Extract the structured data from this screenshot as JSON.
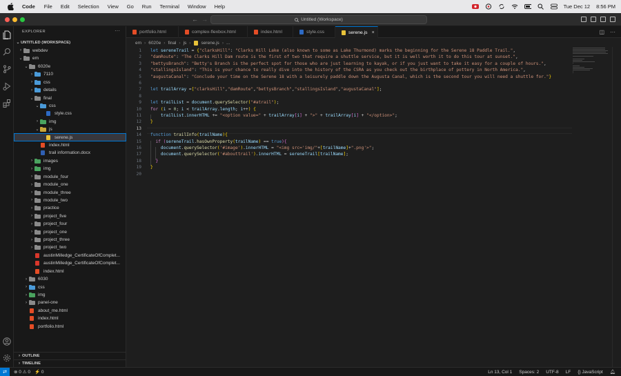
{
  "menubar": {
    "app": "Code",
    "items": [
      "File",
      "Edit",
      "Selection",
      "View",
      "Go",
      "Run",
      "Terminal",
      "Window",
      "Help"
    ],
    "clock_date": "Tue Dec 12",
    "clock_time": "8:56 PM"
  },
  "titlebar": {
    "command_center": "Untitled (Workspace)"
  },
  "sidebar": {
    "title": "EXPLORER",
    "workspace": "UNTITLED (WORKSPACE)",
    "tree": [
      {
        "label": "webdev",
        "icon": "folder",
        "indent": 1,
        "chevron": "›"
      },
      {
        "label": "em",
        "icon": "folder",
        "indent": 1,
        "chevron": "⌄"
      },
      {
        "label": "6020e",
        "icon": "folder",
        "indent": 2,
        "chevron": "⌄"
      },
      {
        "label": "7110",
        "icon": "folder blue",
        "indent": 3,
        "chevron": "›"
      },
      {
        "label": "css",
        "icon": "folder blue",
        "indent": 3,
        "chevron": "›"
      },
      {
        "label": "details",
        "icon": "folder blue",
        "indent": 3,
        "chevron": "›"
      },
      {
        "label": "final",
        "icon": "folder",
        "indent": 3,
        "chevron": "⌄"
      },
      {
        "label": "css",
        "icon": "folder blue",
        "indent": 4,
        "chevron": "⌄"
      },
      {
        "label": "style.css",
        "icon": "file-css",
        "indent": 5,
        "chevron": ""
      },
      {
        "label": "img",
        "icon": "folder green",
        "indent": 4,
        "chevron": "›"
      },
      {
        "label": "js",
        "icon": "folder yellow",
        "indent": 4,
        "chevron": "⌄"
      },
      {
        "label": "serene.js",
        "icon": "file-js",
        "indent": 5,
        "chevron": "",
        "selected": true
      },
      {
        "label": "index.html",
        "icon": "file-html",
        "indent": 4,
        "chevron": ""
      },
      {
        "label": "trail information.docx",
        "icon": "file-doc",
        "indent": 4,
        "chevron": ""
      },
      {
        "label": "images",
        "icon": "folder green",
        "indent": 3,
        "chevron": "›"
      },
      {
        "label": "img",
        "icon": "folder green",
        "indent": 3,
        "chevron": "›"
      },
      {
        "label": "module_four",
        "icon": "folder",
        "indent": 3,
        "chevron": "›"
      },
      {
        "label": "module_one",
        "icon": "folder",
        "indent": 3,
        "chevron": "›"
      },
      {
        "label": "module_three",
        "icon": "folder",
        "indent": 3,
        "chevron": "›"
      },
      {
        "label": "module_two",
        "icon": "folder",
        "indent": 3,
        "chevron": "›"
      },
      {
        "label": "practice",
        "icon": "folder",
        "indent": 3,
        "chevron": "›"
      },
      {
        "label": "project_five",
        "icon": "folder",
        "indent": 3,
        "chevron": "›"
      },
      {
        "label": "project_four",
        "icon": "folder",
        "indent": 3,
        "chevron": "›"
      },
      {
        "label": "project_one",
        "icon": "folder",
        "indent": 3,
        "chevron": "›"
      },
      {
        "label": "project_three",
        "icon": "folder",
        "indent": 3,
        "chevron": "›"
      },
      {
        "label": "project_two",
        "icon": "folder",
        "indent": 3,
        "chevron": "›"
      },
      {
        "label": "austinMilledge_CertificateOfComplet...",
        "icon": "file-pdf",
        "indent": 3,
        "chevron": ""
      },
      {
        "label": "austinMilledge_CertificateOfComplet...",
        "icon": "file-pdf",
        "indent": 3,
        "chevron": ""
      },
      {
        "label": "index.html",
        "icon": "file-html",
        "indent": 3,
        "chevron": ""
      },
      {
        "label": "6030",
        "icon": "folder",
        "indent": 2,
        "chevron": "›"
      },
      {
        "label": "css",
        "icon": "folder blue",
        "indent": 2,
        "chevron": "›"
      },
      {
        "label": "img",
        "icon": "folder green",
        "indent": 2,
        "chevron": "›"
      },
      {
        "label": "panel-one",
        "icon": "folder",
        "indent": 2,
        "chevron": "›"
      },
      {
        "label": "about_me.html",
        "icon": "file-html",
        "indent": 2,
        "chevron": ""
      },
      {
        "label": "index.html",
        "icon": "file-html",
        "indent": 2,
        "chevron": ""
      },
      {
        "label": "portfolio.html",
        "icon": "file-html",
        "indent": 2,
        "chevron": ""
      }
    ],
    "outline": "OUTLINE",
    "timeline": "TIMELINE"
  },
  "tabs": [
    {
      "label": "portfolio.html",
      "icon": "file-html"
    },
    {
      "label": "complex-flexbox.html",
      "icon": "file-html"
    },
    {
      "label": "index.html",
      "icon": "file-html"
    },
    {
      "label": "style.css",
      "icon": "file-css"
    },
    {
      "label": "serene.js",
      "icon": "file-js",
      "active": true
    }
  ],
  "breadcrumb": [
    "em",
    "6020e",
    "final",
    "js",
    "serene.js",
    "..."
  ],
  "code": {
    "current_line": 13,
    "lines": [
      "<span class=\"k\">let</span> <span class=\"v\">sereneTrail</span> <span class=\"p\">=</span> <span class=\"br\">{</span><span class=\"s\">\"clarksHill\"</span><span class=\"p\">: </span><span class=\"s\">\"Clarks Hill Lake (also known to some as Lake Thurmond) marks the beginning for the Serene 18 Paddle Trail.\"</span><span class=\"p\">,</span>",
      "<span class=\"s\">\"damRoute\"</span><span class=\"p\">: </span><span class=\"s\">\"The Clarks Hill Dam route is the first of two that require a shuttle service, but it is well worth it to do this tour at sunset.\"</span><span class=\"p\">,</span>",
      "<span class=\"s\">\"bettysBranch\"</span><span class=\"p\">: </span><span class=\"s\">\"Betty's Branch is the perfect spot for those who are just learning to kayak, or if you just want to take it easy for a couple of hours.\"</span><span class=\"p\">,</span>",
      "<span class=\"s\">\"stallingsIsland\"</span><span class=\"p\">: </span><span class=\"s\">\"This is your chance to really dive into the history of the CSRA as you check out the birthplace of pottery in North America.\"</span><span class=\"p\">,</span>",
      "<span class=\"s\">\"augustaCanal\"</span><span class=\"p\">: </span><span class=\"s\">\"Conclude your time on the Serene 18 with a leisurely paddle down the Augusta Canal, which is the second tour you will need a shuttle for.\"</span><span class=\"br\">}</span>",
      "",
      "<span class=\"k\">let</span> <span class=\"v\">trailArray</span> <span class=\"p\">=</span><span class=\"br\">[</span><span class=\"s\">\"clarksHill\"</span><span class=\"p\">,</span><span class=\"s\">\"damRoute\"</span><span class=\"p\">,</span><span class=\"s\">\"bettysBranch\"</span><span class=\"p\">,</span><span class=\"s\">\"stallingsIsland\"</span><span class=\"p\">,</span><span class=\"s\">\"augustaCanal\"</span><span class=\"br\">]</span><span class=\"p\">;</span>",
      "",
      "<span class=\"k\">let</span> <span class=\"v\">trailList</span> <span class=\"p\">= </span><span class=\"v\">document</span><span class=\"p\">.</span><span class=\"f\">querySelector</span><span class=\"br\">(</span><span class=\"s\">\"#atrail\"</span><span class=\"br\">)</span><span class=\"p\">;</span>",
      "<span class=\"kc\">for</span> <span class=\"br\">(</span><span class=\"v\">i</span> <span class=\"p\">= </span><span class=\"n\">0</span><span class=\"p\">; </span><span class=\"v\">i</span> <span class=\"p\">&lt; </span><span class=\"v\">trailArray</span><span class=\"p\">.</span><span class=\"v\">length</span><span class=\"p\">; </span><span class=\"v\">i</span><span class=\"p\">++</span><span class=\"br\">)</span> <span class=\"br\">{</span>",
      "    <span class=\"v\">trailList</span><span class=\"p\">.</span><span class=\"v\">innerHTML</span> <span class=\"p\">+= </span><span class=\"s\">\"&lt;option value=\"</span> <span class=\"p\">+ </span><span class=\"v\">trailArray</span><span class=\"br2\">[</span><span class=\"v\">i</span><span class=\"br2\">]</span> <span class=\"p\">+ </span><span class=\"s\">\"&gt;\"</span> <span class=\"p\">+ </span><span class=\"v\">trailArray</span><span class=\"br2\">[</span><span class=\"v\">i</span><span class=\"br2\">]</span> <span class=\"p\">+ </span><span class=\"s\">\"&lt;/option&gt;\"</span><span class=\"p\">;</span>",
      "<span class=\"br\">}</span>",
      "",
      "<span class=\"k\">function</span> <span class=\"f\">trailInfo</span><span class=\"br\">(</span><span class=\"v\">trailName</span><span class=\"br\">)</span><span class=\"br\">{</span>",
      "  <span class=\"kc\">if</span> <span class=\"br2\">(</span><span class=\"v\">sereneTrail</span><span class=\"p\">.</span><span class=\"f\">hasOwnProperty</span><span class=\"br\">(</span><span class=\"v\">trailName</span><span class=\"br\">)</span> <span class=\"p\">== </span><span class=\"k\">true</span><span class=\"br2\">)</span><span class=\"br2\">{</span>",
      "    <span class=\"v\">document</span><span class=\"p\">.</span><span class=\"f\">querySelector</span><span class=\"br\">(</span><span class=\"s\">'#image'</span><span class=\"br\">)</span><span class=\"p\">.</span><span class=\"v\">innerHTML</span> <span class=\"p\">= </span><span class=\"s\">\"&lt;img src='img/\"</span><span class=\"p\">+</span><span class=\"br\">[</span><span class=\"v\">trailName</span><span class=\"br\">]</span><span class=\"p\">+</span><span class=\"s\">\".png'&gt;\"</span><span class=\"p\">;</span>",
      "    <span class=\"v\">document</span><span class=\"p\">.</span><span class=\"f\">querySelector</span><span class=\"br\">(</span><span class=\"s\">'#abouttrail'</span><span class=\"br\">)</span><span class=\"p\">.</span><span class=\"v\">innerHTML</span> <span class=\"p\">= </span><span class=\"v\">sereneTrail</span><span class=\"br\">[</span><span class=\"v\">trailName</span><span class=\"br\">]</span><span class=\"p\">;</span>",
      "  <span class=\"br2\">}</span>",
      "<span class=\"br\">}</span>",
      ""
    ]
  },
  "statusbar": {
    "errors": "0",
    "warnings": "0",
    "ports": "0",
    "position": "Ln 13, Col 1",
    "spaces": "Spaces: 2",
    "encoding": "UTF-8",
    "eol": "LF",
    "language": "JavaScript"
  }
}
